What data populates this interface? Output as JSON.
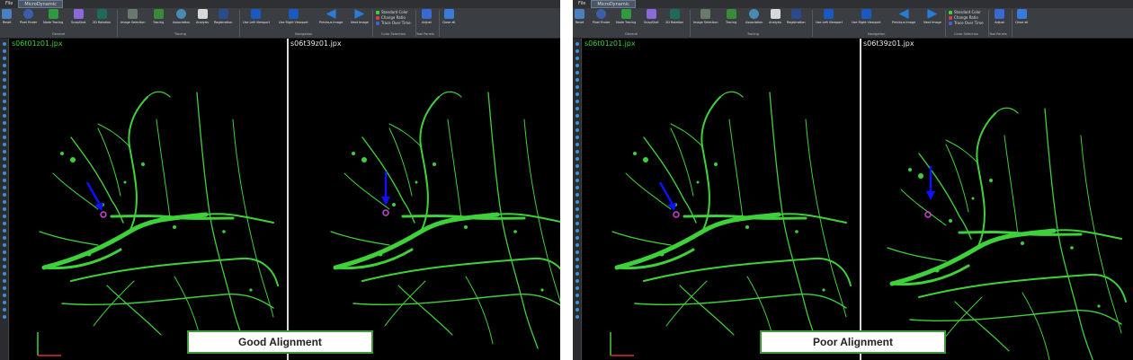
{
  "menu": {
    "file": "File",
    "tab": "MicroDynamic"
  },
  "toolbar": {
    "reset": "Reset",
    "pixel_finder": "Pixel Finder",
    "node_tracing": "Node Tracing",
    "snapshot": "SnapShot",
    "rotation_2d": "2D Rotation",
    "image_selection": "Image Selection",
    "tracing": "Tracing",
    "association": "Association",
    "analysis": "Analysis",
    "registration": "Registration",
    "use_left_viewport": "Use Left Viewport",
    "use_right_viewport": "Use Right Viewport",
    "previous_image": "Previous Image",
    "next_image": "Next Image",
    "adjust": "Adjust",
    "close_all": "Close all",
    "color_standard": "Standard Color",
    "color_ratio": "Change Ratio",
    "color_trace": "Trace Over Time",
    "group_general": "General",
    "group_tracing": "Tracing",
    "group_navigation": "Navigation",
    "group_color": "Color Selection",
    "group_tool": "Tool Panels"
  },
  "left_panel": {
    "left_file": "s06t01z01.jpx",
    "right_file": "s06t39z01.jpx",
    "label": "Good Alignment"
  },
  "right_panel": {
    "left_file": "s06t01z01.jpx",
    "right_file": "s06t39z01.jpx",
    "label": "Poor Alignment"
  },
  "colors": {
    "neuron": "#3fd13a",
    "arrow": "#1010ff",
    "marker": "#d040d0",
    "banner_border": "#3c9a3c"
  }
}
